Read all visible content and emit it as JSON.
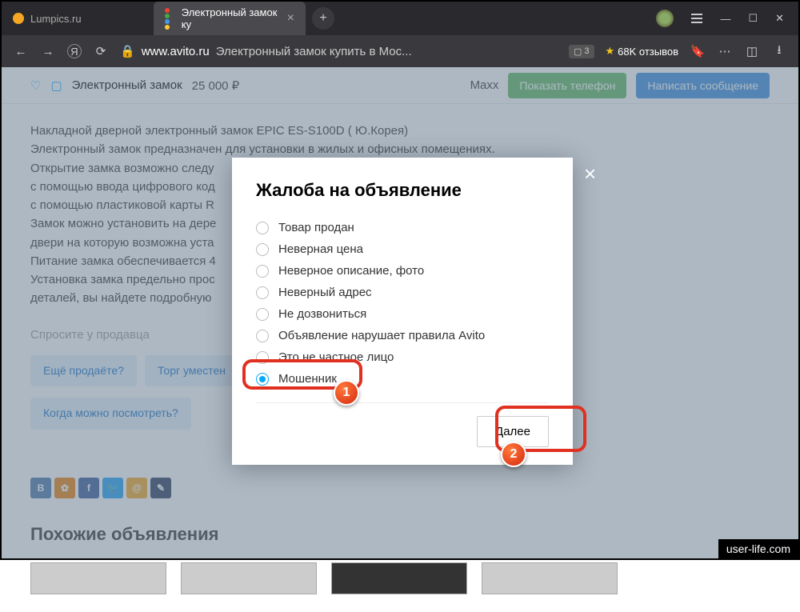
{
  "browser": {
    "tabs": [
      {
        "title": "Lumpics.ru",
        "active": false
      },
      {
        "title": "Электронный замок ку",
        "active": true
      }
    ],
    "url_domain": "www.avito.ru",
    "url_title": "Электронный замок купить в Мос...",
    "ext_badge": "3",
    "reviews": "68K отзывов"
  },
  "sticky": {
    "title": "Электронный замок",
    "price": "25 000  ₽",
    "seller": "Maxx",
    "phone_btn": "Показать телефон",
    "msg_btn": "Написать сообщение"
  },
  "desc": {
    "l1": "Накладной  дверной электронный замок EPIC ES-S100D ( Ю.Корея)",
    "l2": "Электронный замок предназначен для установки в жилых и офисных помещениях.",
    "l3": "Открытие замка возможно следу",
    "l4": " с помощью ввода цифрового код",
    "l5": " с помощью пластиковой карты R",
    "l6": "Замок можно установить на дере",
    "l7": "двери на которую возможна уста",
    "l8": "Питание замка обеспечивается 4",
    "l9": "Установка замка предельно прос",
    "l10": "деталей, вы найдете подробную"
  },
  "ask": {
    "header": "Спросите у продавца",
    "chips": [
      "Ещё продаёте?",
      "Торг уместен",
      "Когда можно посмотреть?"
    ]
  },
  "similar": "Похожие объявления",
  "modal": {
    "title": "Жалоба на объявление",
    "options": [
      "Товар продан",
      "Неверная цена",
      "Неверное описание, фото",
      "Неверный адрес",
      "Не дозвониться",
      "Объявление нарушает правила Avito",
      "Это не частное лицо",
      "Мошенник"
    ],
    "selected_index": 7,
    "next": "Далее"
  },
  "annotations": {
    "n1": "1",
    "n2": "2"
  },
  "watermark": "user-life.com"
}
